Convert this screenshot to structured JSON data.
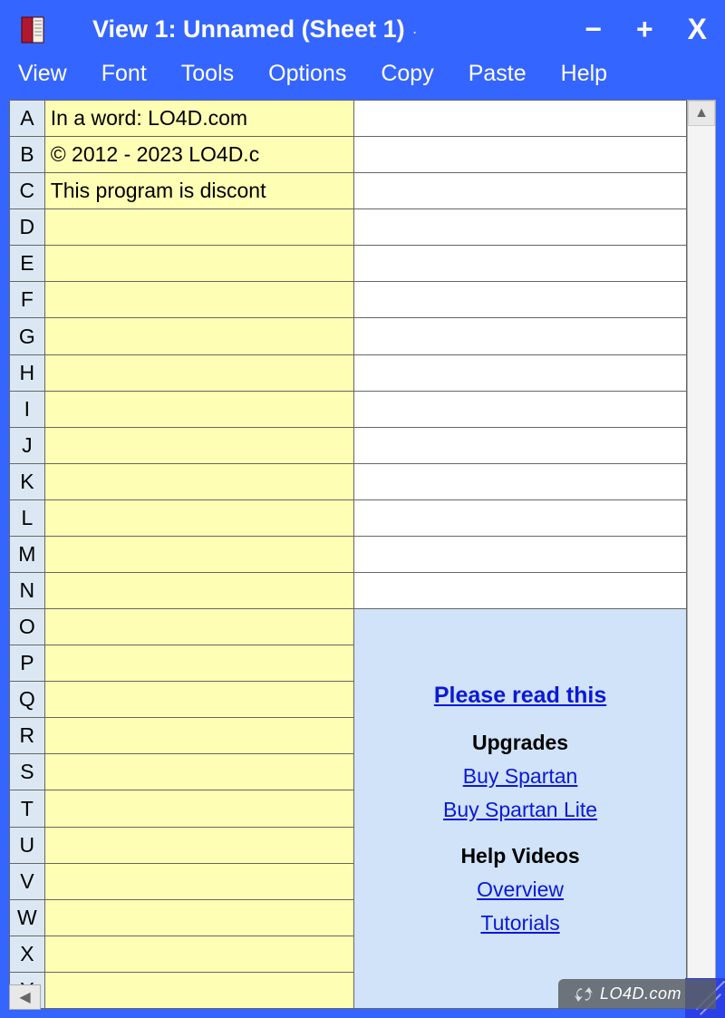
{
  "window": {
    "title": "View 1: Unnamed (Sheet 1)",
    "minimize": "−",
    "maximize": "+",
    "close": "X"
  },
  "menu": {
    "items": [
      "View",
      "Font",
      "Tools",
      "Options",
      "Copy",
      "Paste",
      "Help"
    ]
  },
  "grid": {
    "rows": [
      {
        "hdr": "A",
        "colA": "In a word: LO4D.com",
        "colB": ""
      },
      {
        "hdr": "B",
        "colA": "© 2012 - 2023 LO4D.c",
        "colB": ""
      },
      {
        "hdr": "C",
        "colA": "This program is discont",
        "colB": ""
      },
      {
        "hdr": "D",
        "colA": "",
        "colB": ""
      },
      {
        "hdr": "E",
        "colA": "",
        "colB": ""
      },
      {
        "hdr": "F",
        "colA": "",
        "colB": ""
      },
      {
        "hdr": "G",
        "colA": "",
        "colB": ""
      },
      {
        "hdr": "H",
        "colA": "",
        "colB": ""
      },
      {
        "hdr": "I",
        "colA": "",
        "colB": ""
      },
      {
        "hdr": "J",
        "colA": "",
        "colB": ""
      },
      {
        "hdr": "K",
        "colA": "",
        "colB": ""
      },
      {
        "hdr": "L",
        "colA": "",
        "colB": ""
      },
      {
        "hdr": "M",
        "colA": "",
        "colB": ""
      },
      {
        "hdr": "N",
        "colA": "",
        "colB": ""
      },
      {
        "hdr": "O",
        "colA": "",
        "colB": ""
      },
      {
        "hdr": "P",
        "colA": "",
        "colB": ""
      },
      {
        "hdr": "Q",
        "colA": "",
        "colB": ""
      },
      {
        "hdr": "R",
        "colA": "",
        "colB": ""
      },
      {
        "hdr": "S",
        "colA": "",
        "colB": ""
      },
      {
        "hdr": "T",
        "colA": "",
        "colB": ""
      },
      {
        "hdr": "U",
        "colA": "",
        "colB": ""
      },
      {
        "hdr": "V",
        "colA": "",
        "colB": ""
      },
      {
        "hdr": "W",
        "colA": "",
        "colB": ""
      },
      {
        "hdr": "X",
        "colA": "",
        "colB": ""
      },
      {
        "hdr": "Y",
        "colA": "",
        "colB": ""
      }
    ]
  },
  "infoPanel": {
    "readThis": "Please read this",
    "upgradesTitle": "Upgrades",
    "buySpartan": "Buy Spartan",
    "buySpartanLite": "Buy Spartan Lite",
    "helpVideosTitle": "Help Videos",
    "overview": "Overview",
    "tutorials": "Tutorials"
  },
  "watermark": "LO4D.com"
}
